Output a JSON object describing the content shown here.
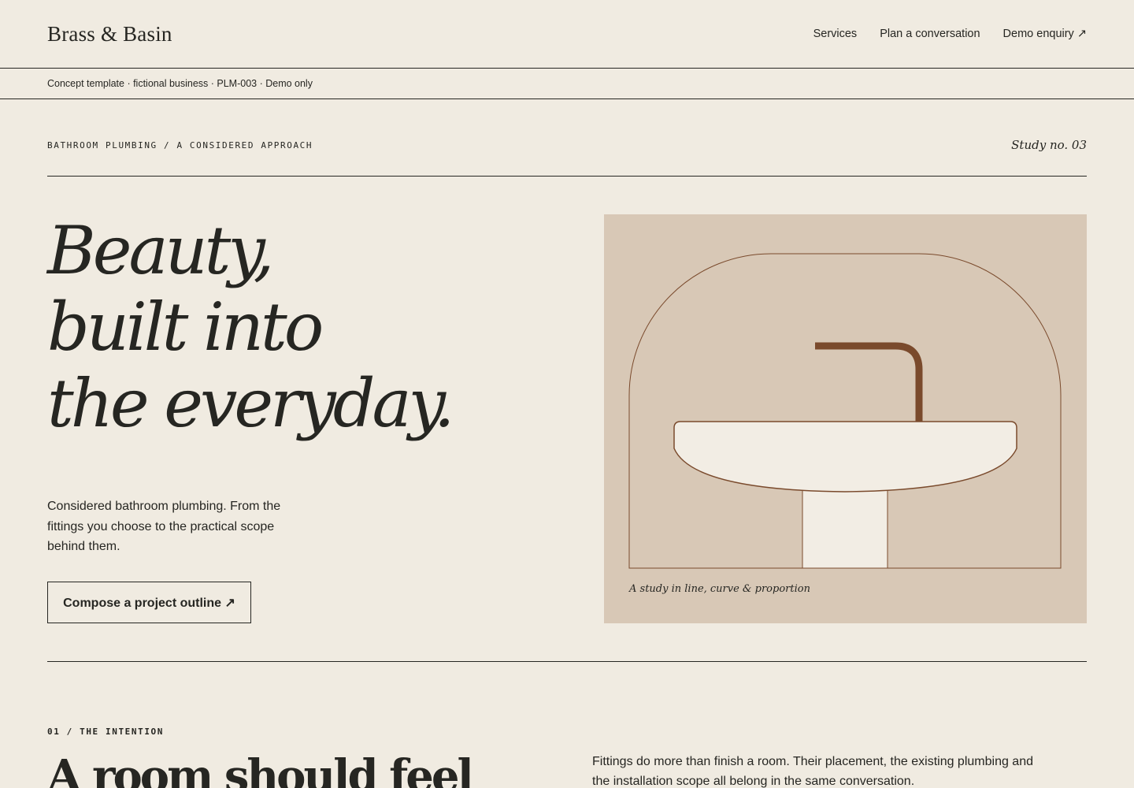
{
  "header": {
    "brand": "Brass & Basin",
    "nav": [
      "Services",
      "Plan a conversation",
      "Demo enquiry ↗"
    ]
  },
  "notice": "Concept template · fictional business · PLM-003 · Demo only",
  "hero": {
    "eyebrow": "BATHROOM PLUMBING / A CONSIDERED APPROACH",
    "study": "Study no. 03",
    "title_lines": [
      "Beauty,",
      "built into",
      "the everyday."
    ],
    "subtitle": "Considered bathroom plumbing. From the fittings you choose to the practical scope behind them.",
    "cta": "Compose a project outline ↗",
    "illustration_caption": "A study in line, curve & proportion"
  },
  "intention": {
    "eyebrow": "01 / THE INTENTION",
    "title": "A room should feel",
    "body": "Fittings do more than finish a room. Their placement, the existing plumbing and the installation scope all belong in the same conversation."
  },
  "colors": {
    "background": "#f0ebe1",
    "ink": "#262622",
    "panel": "#d8c8b6",
    "brass": "#7a4a2c",
    "porcelain": "#f2ede4"
  }
}
